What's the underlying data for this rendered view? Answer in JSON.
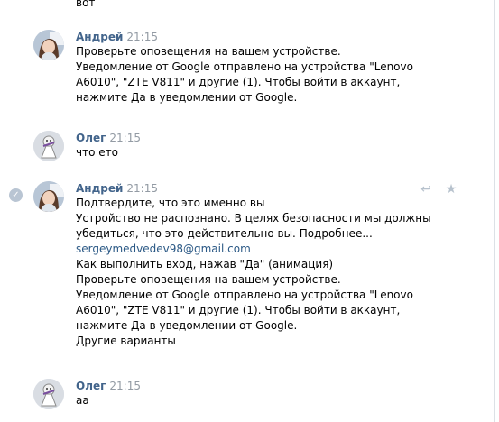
{
  "top_partial_text": "вот",
  "messages": [
    {
      "sender": "Андрей",
      "time": "21:15",
      "lines": [
        "Проверьте оповещения на вашем устройстве.",
        "Уведомление от Google отправлено на устройства \"Lenovo",
        "A6010\", \"ZTE V811\" и другие (1). Чтобы войти в аккаунт,",
        "нажмите Да в уведомлении от Google."
      ]
    },
    {
      "sender": "Олег",
      "time": "21:15",
      "lines": [
        "что ето"
      ]
    },
    {
      "sender": "Андрей",
      "time": "21:15",
      "lines": [
        "Подтвердите, что это именно вы",
        "Устройство не распознано. В целях безопасности мы должны",
        "убедиться, что это действительно вы. Подробнее...",
        "sergeymedvedev98@gmail.com",
        "Как выполнить вход, нажав \"Да\" (анимация)",
        "Проверьте оповещения на вашем устройстве.",
        "Уведомление от Google отправлено на устройства \"Lenovo",
        "A6010\", \"ZTE V811\" и другие (1). Чтобы войти в аккаунт,",
        "нажмите Да в уведомлении от Google.",
        "Другие варианты"
      ],
      "actions": {
        "reply_icon": "reply-icon",
        "star_icon": "star-icon",
        "check_icon": "check-circle-icon"
      }
    },
    {
      "sender": "Олег",
      "time": "21:15",
      "lines": [
        "аа"
      ]
    }
  ],
  "colors": {
    "sender": "#42648b",
    "time": "#939ba4",
    "link": "#2a5885",
    "text": "#000000"
  }
}
